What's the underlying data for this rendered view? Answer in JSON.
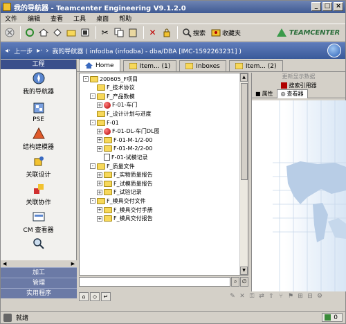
{
  "window": {
    "title": "我的导航器 - Teamcenter Engineering V9.1.2.0"
  },
  "menu": [
    "文件",
    "编辑",
    "查看",
    "工具",
    "桌面",
    "帮助"
  ],
  "toolbar": {
    "search_label": "搜索",
    "favorites_label": "收藏夹",
    "brand": "TEAMCENTER"
  },
  "nav": {
    "back_label": "上一步",
    "path": "我的导航器 ( infodba (infodba) - dba/DBA [IMC-1592263231] )"
  },
  "sidebar": {
    "header": "工程",
    "items": [
      {
        "label": "我的导航器",
        "icon": "navigator-icon"
      },
      {
        "label": "PSE",
        "icon": "pse-icon"
      },
      {
        "label": "结构建模器",
        "icon": "structure-modeler-icon"
      },
      {
        "label": "关联设计",
        "icon": "related-design-icon"
      },
      {
        "label": "关联协作",
        "icon": "collaboration-icon"
      },
      {
        "label": "CM 查看器",
        "icon": "cm-viewer-icon"
      }
    ],
    "bottom": [
      "加工",
      "管理",
      "实用程序"
    ]
  },
  "tabs": [
    "Home",
    "Item... (1)",
    "Inboxes",
    "Item... (2)"
  ],
  "tree": [
    {
      "label": "200605_F项目",
      "depth": 0,
      "icon": "folder",
      "exp": "-"
    },
    {
      "label": "F_技术协议",
      "depth": 1,
      "icon": "folder",
      "exp": ""
    },
    {
      "label": "F_产品数模",
      "depth": 1,
      "icon": "folder",
      "exp": "-"
    },
    {
      "label": "F-01-车门",
      "depth": 2,
      "icon": "ball",
      "exp": "+"
    },
    {
      "label": "F_设计计划与进度",
      "depth": 1,
      "icon": "folder",
      "exp": ""
    },
    {
      "label": "F-01",
      "depth": 1,
      "icon": "folder",
      "exp": "-"
    },
    {
      "label": "F-01-DL-车门DL图",
      "depth": 2,
      "icon": "ball",
      "exp": "+"
    },
    {
      "label": "F-01-M-1/2-00",
      "depth": 2,
      "icon": "folder",
      "exp": "+"
    },
    {
      "label": "F-01-M-2/2-00",
      "depth": 2,
      "icon": "folder",
      "exp": "+"
    },
    {
      "label": "F-01-试模记录",
      "depth": 2,
      "icon": "doc",
      "exp": ""
    },
    {
      "label": "F_质量文件",
      "depth": 1,
      "icon": "folder",
      "exp": "-"
    },
    {
      "label": "F_实物质量报告",
      "depth": 2,
      "icon": "folder",
      "exp": "+"
    },
    {
      "label": "F_试模质量报告",
      "depth": 2,
      "icon": "folder",
      "exp": "+"
    },
    {
      "label": "F_试验记录",
      "depth": 2,
      "icon": "folder",
      "exp": "+"
    },
    {
      "label": "F_模具交付文件",
      "depth": 1,
      "icon": "folder",
      "exp": "-"
    },
    {
      "label": "F_模具交付手册",
      "depth": 2,
      "icon": "folder",
      "exp": "+"
    },
    {
      "label": "F_模具交付报告",
      "depth": 2,
      "icon": "folder",
      "exp": "+"
    }
  ],
  "search": {
    "value": ""
  },
  "right": {
    "refresh_label": "更新显示数据",
    "source_label": "搜索引用器",
    "tab_props": "属性",
    "tab_viewer": "查看器"
  },
  "status": {
    "text": "就绪",
    "count": "0"
  },
  "colors": {
    "accent": "#3f5a93",
    "folder": "#f7d85a"
  }
}
